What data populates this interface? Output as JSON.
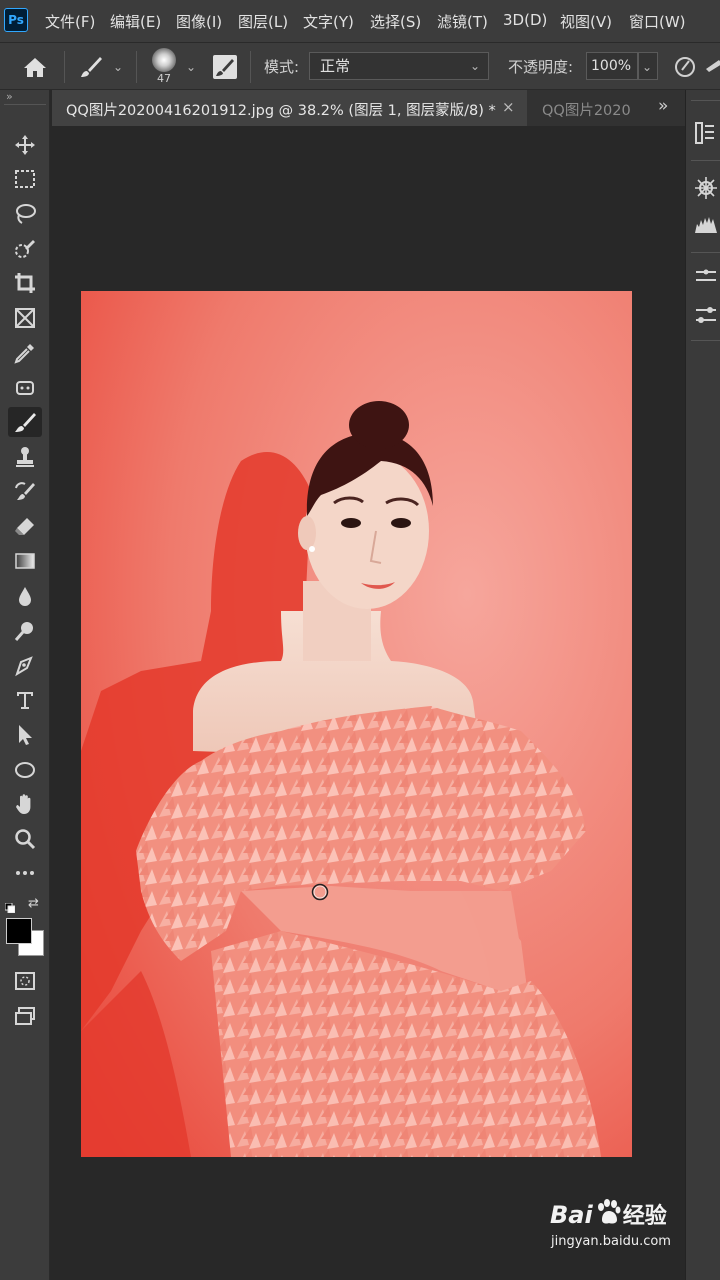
{
  "app": {
    "logo_text": "Ps"
  },
  "menu": [
    {
      "label": "文件(F)"
    },
    {
      "label": "编辑(E)"
    },
    {
      "label": "图像(I)"
    },
    {
      "label": "图层(L)"
    },
    {
      "label": "文字(Y)"
    },
    {
      "label": "选择(S)"
    },
    {
      "label": "滤镜(T)"
    },
    {
      "label": "3D(D)"
    },
    {
      "label": "视图(V)"
    },
    {
      "label": "窗口(W)"
    }
  ],
  "options": {
    "brush_size": "47",
    "mode_label": "模式:",
    "mode_value": "正常",
    "opacity_label": "不透明度:",
    "opacity_value": "100%"
  },
  "tabs": [
    {
      "label": "QQ图片20200416201912.jpg @ 38.2% (图层 1, 图层蒙版/8) *",
      "active": true
    },
    {
      "label": "QQ图片2020",
      "active": false
    }
  ],
  "tabs_overflow": "»",
  "tools": [
    "move-tool-icon",
    "marquee-tool-icon",
    "lasso-tool-icon",
    "quick-select-tool-icon",
    "crop-tool-icon",
    "frame-tool-icon",
    "eyedropper-tool-icon",
    "patch-tool-icon",
    "brush-tool-icon",
    "stamp-tool-icon",
    "history-brush-tool-icon",
    "eraser-tool-icon",
    "gradient-tool-icon",
    "blur-tool-icon",
    "dodge-tool-icon",
    "pen-tool-icon",
    "type-tool-icon",
    "path-select-tool-icon",
    "ellipse-tool-icon",
    "hand-tool-icon",
    "zoom-tool-icon",
    "more-tools-icon"
  ],
  "colors": {
    "foreground": "#000000",
    "background": "#ffffff",
    "mask_overlay": "#e8473a",
    "accent": "#31a8ff"
  },
  "watermark": {
    "brand": "Bai",
    "brand2": "经验",
    "url": "jingyan.baidu.com"
  }
}
